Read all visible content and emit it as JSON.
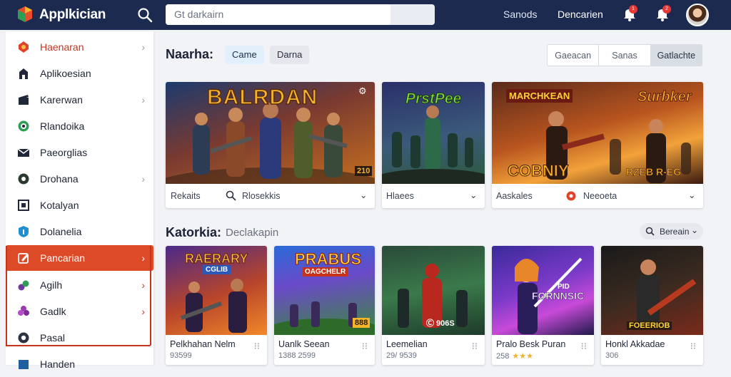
{
  "header": {
    "title": "Applkician",
    "search_placeholder": "Gt darkairn",
    "nav_links": [
      "Sanods",
      "Dencarien"
    ],
    "badges": [
      "1",
      "2"
    ],
    "colors": {
      "bar": "#1b2a4e",
      "accent": "#dd4a27"
    }
  },
  "sidebar": {
    "items": [
      {
        "label": "Haenaran",
        "icon": "gem-icon",
        "chevron": true,
        "state": "highlight"
      },
      {
        "label": "Aplikoesian",
        "icon": "tower-icon",
        "chevron": false
      },
      {
        "label": "Karerwan",
        "icon": "clapboard-icon",
        "chevron": true
      },
      {
        "label": "Rlandoika",
        "icon": "globe-icon",
        "chevron": false
      },
      {
        "label": "Paeorglias",
        "icon": "envelope-icon",
        "chevron": false
      },
      {
        "label": "Drohana",
        "icon": "disc-icon",
        "chevron": true
      },
      {
        "label": "Kotalyan",
        "icon": "puzzle-icon",
        "chevron": false
      },
      {
        "label": "Dolanelia",
        "icon": "shield-icon",
        "chevron": false
      },
      {
        "label": "Pancarian",
        "icon": "pencil-icon",
        "chevron": true,
        "state": "active"
      },
      {
        "label": "Agilh",
        "icon": "leaf-icon",
        "chevron": true
      },
      {
        "label": "Gadlk",
        "icon": "flower-icon",
        "chevron": true
      },
      {
        "label": "Pasal",
        "icon": "ring-icon",
        "chevron": false
      },
      {
        "label": "Handen",
        "icon": "box-icon",
        "chevron": false
      }
    ]
  },
  "featured": {
    "title": "Naarha:",
    "chips": [
      "Came",
      "Darna"
    ],
    "segmented": [
      "Gaeacan",
      "Sanas",
      "Gatlachte"
    ],
    "cards": [
      {
        "art_title": "BALRDAN",
        "art_badge": "210",
        "foot_left": "Rekaits",
        "foot_right": "Rlosekkis",
        "has_search_icon": true
      },
      {
        "art_title": "PrstPee",
        "art_badge": "",
        "foot_left": "Hlaees",
        "foot_right": "",
        "has_search_icon": false
      },
      {
        "art_title": "MARCHKEAN",
        "art_title2": "Surbker",
        "art_badge": "COBNIY",
        "art_badge2": "RZEB R-EG",
        "foot_left": "Aaskales",
        "foot_right": "Neeoeta",
        "has_search_icon": false
      }
    ]
  },
  "catalog": {
    "title": "Katorkia:",
    "subtitle": "Declakapin",
    "sort_label": "Bereain",
    "items": [
      {
        "art_title": "RAERARY",
        "art_sub": "CGLIB",
        "title": "Pelkhahan Nelm",
        "sub": "93599",
        "stars": ""
      },
      {
        "art_title": "PRABUS",
        "art_sub": "OAGCHELR",
        "art_badge": "888",
        "title": "Uanlk Seean",
        "sub": "1388 2599",
        "stars": ""
      },
      {
        "art_title": "",
        "art_badge": "Ⓒ 906S",
        "title": "Leemelian",
        "sub": "29/ 9539",
        "stars": ""
      },
      {
        "art_title": "FORNNSIC",
        "art_sub": "PID",
        "title": "Pralo Besk Puran",
        "sub": "258",
        "stars": "★★★"
      },
      {
        "art_title": "",
        "art_badge": "FOEERIOB",
        "title": "Honkl Akkadae",
        "sub": "306",
        "stars": ""
      }
    ]
  }
}
